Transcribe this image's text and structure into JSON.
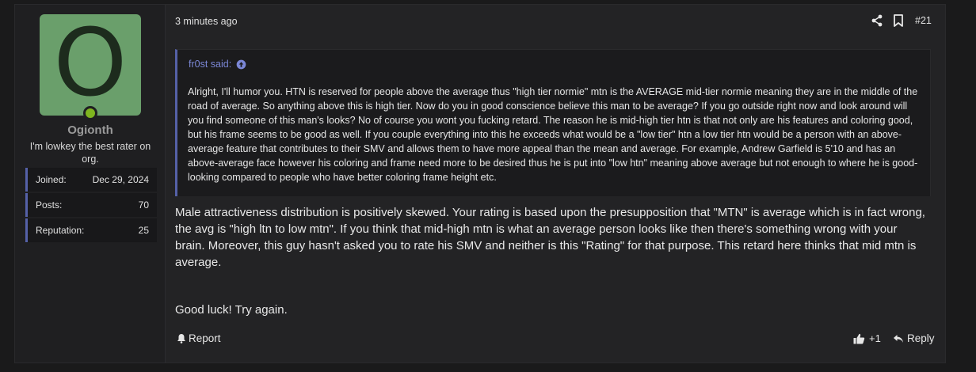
{
  "user": {
    "avatar_letter": "O",
    "avatar_color": "#6a9f6b",
    "online_color": "#7fb51f",
    "username": "Ogionth",
    "title": "I'm lowkey the best rater on org.",
    "stats": [
      {
        "label": "Joined:",
        "value": "Dec 29, 2024"
      },
      {
        "label": "Posts:",
        "value": "70"
      },
      {
        "label": "Reputation:",
        "value": "25"
      }
    ]
  },
  "post": {
    "time": "3 minutes ago",
    "number": "#21",
    "icons": [
      "share-icon",
      "bookmark-icon"
    ]
  },
  "quote": {
    "author": "fr0st said:",
    "text": "Alright, I'll humor you. HTN is reserved for people above the average thus \"high tier normie\" mtn is the AVERAGE mid-tier normie meaning they are in the middle of the road of average. So anything above this is high tier. Now do you in good conscience believe this man to be average? If you go outside right now and look around will you find someone of this man's looks? No of course you wont you fucking retard. The reason he is mid-high tier htn is that not only are his features and coloring good, but his frame seems to be good as well. If you couple everything into this he exceeds what would be a \"low tier\" htn a low tier htn would be a person with an above-average feature that contributes to their SMV and allows them to have more appeal than the mean and average. For example, Andrew Garfield is 5'10 and has an above-average face however his coloring and frame need more to be desired thus he is put into \"low htn\" meaning above average but not enough to where he is good-looking compared to people who have better coloring frame height etc."
  },
  "body": {
    "paragraph": "Male attractiveness distribution is positively skewed. Your rating is based upon the presupposition that \"MTN\" is average which is in fact wrong, the avg is \"high ltn to low mtn\". If you think that mid-high mtn is what an average person looks like then there's something wrong with your brain. Moreover, this guy hasn't asked you to rate his SMV and neither is this \"Rating\" for that purpose. This retard here thinks that mid mtn is average.",
    "closing": "Good luck! Try again."
  },
  "actions": {
    "report": "Report",
    "likes": "+1",
    "reply": "Reply"
  },
  "colors": {
    "accent": "#5561a8",
    "quote_author": "#7b87d6"
  }
}
